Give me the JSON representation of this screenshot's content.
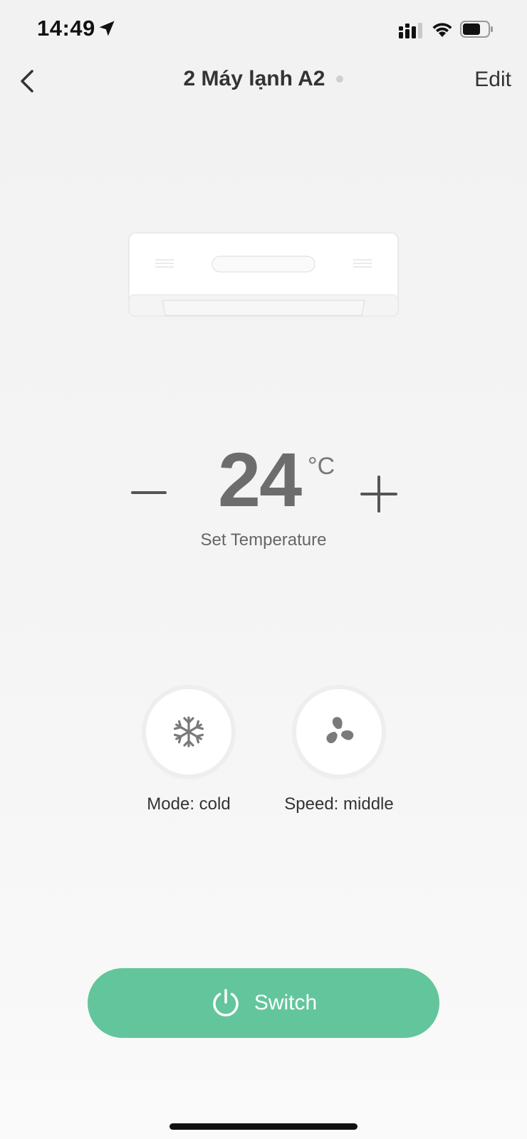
{
  "status_bar": {
    "time": "14:49",
    "icons": [
      "location-arrow-icon",
      "cellular-signal-icon",
      "wifi-icon",
      "battery-icon"
    ]
  },
  "header": {
    "title": "2 Máy lạnh A2",
    "edit_label": "Edit",
    "back_icon": "chevron-left-icon"
  },
  "device": {
    "illustration": "air-conditioner-unit"
  },
  "temperature": {
    "value": "24",
    "unit": "°C",
    "label": "Set Temperature",
    "decrease_icon": "minus-icon",
    "increase_icon": "plus-icon"
  },
  "controls": {
    "mode": {
      "label": "Mode: cold",
      "icon": "snowflake-icon"
    },
    "speed": {
      "label": "Speed: middle",
      "icon": "fan-icon"
    }
  },
  "switch": {
    "label": "Switch",
    "icon": "power-icon"
  },
  "colors": {
    "accent": "#63c59c",
    "background": "#f3f3f3",
    "text": "#333333",
    "temperature": "#6d6d6d",
    "icon": "#7a7a7a"
  }
}
